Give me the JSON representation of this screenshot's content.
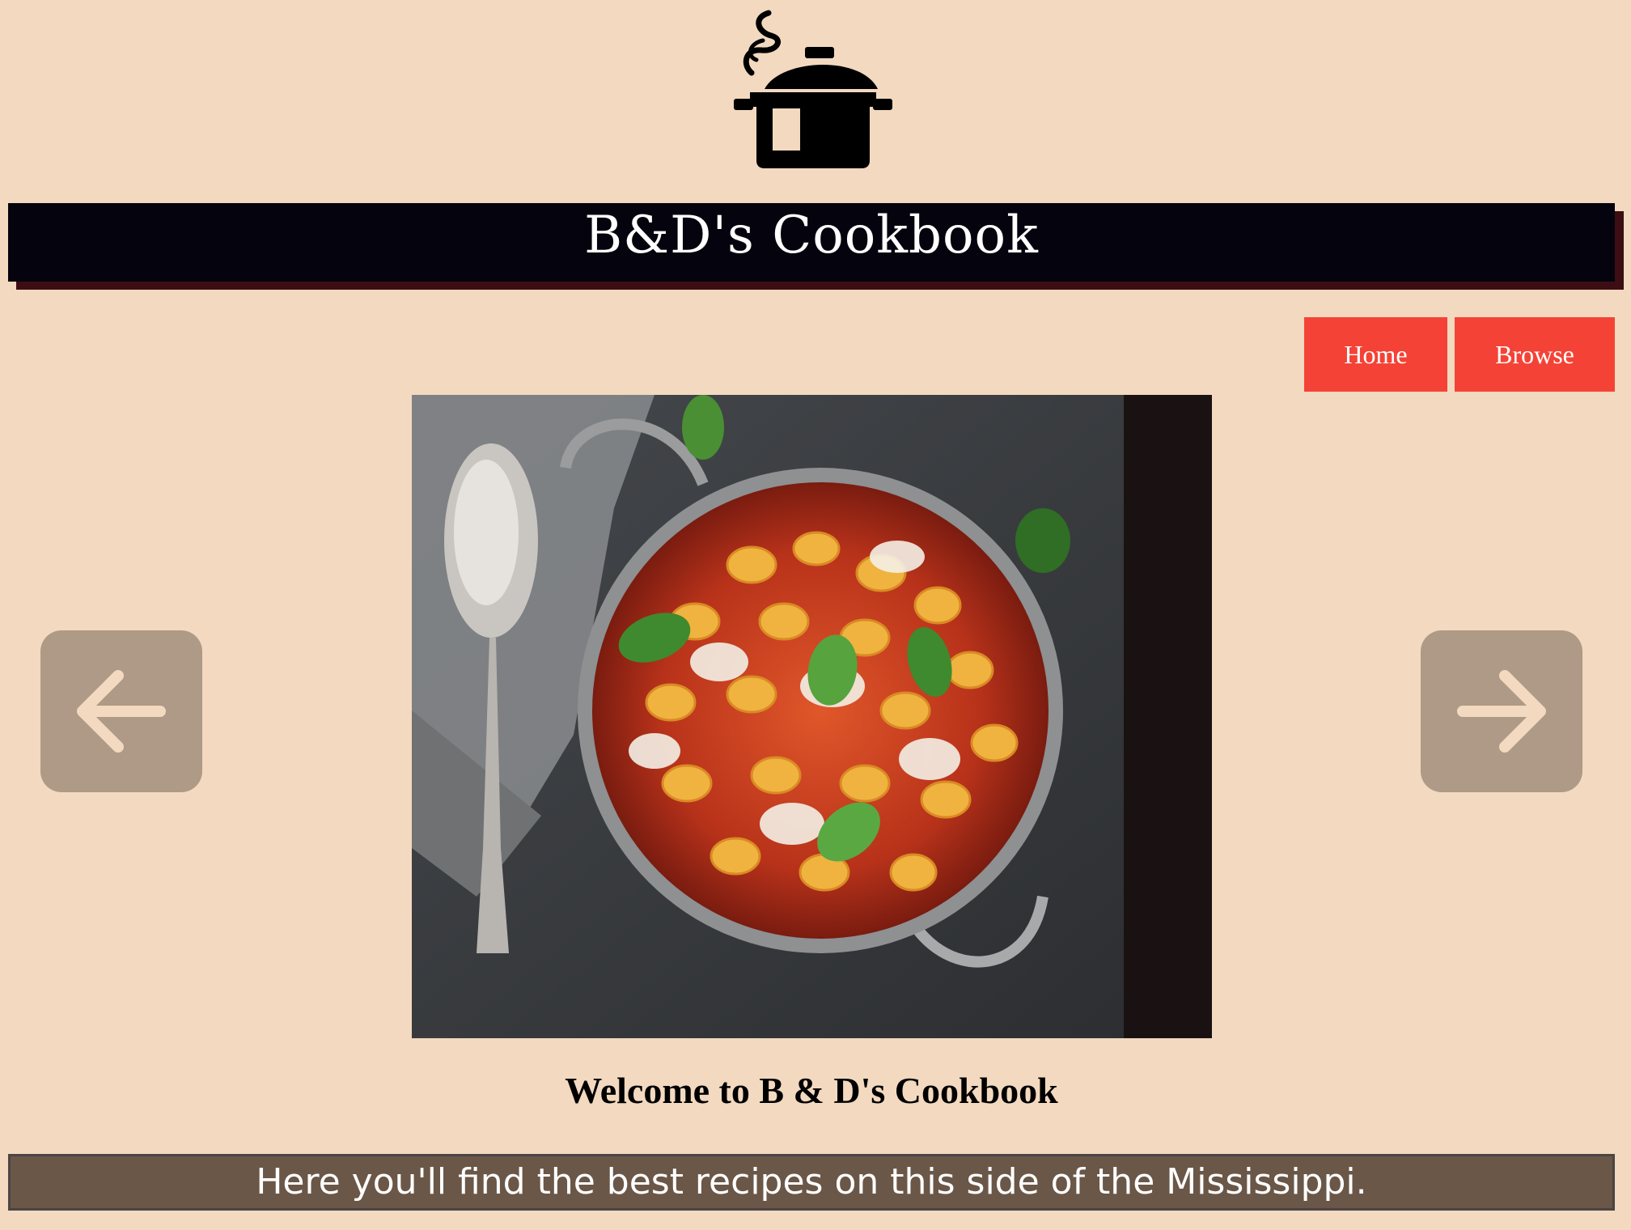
{
  "header": {
    "logo_icon": "cooking-pot-icon",
    "title": "B&D's Cookbook"
  },
  "nav": {
    "home_label": "Home",
    "browse_label": "Browse"
  },
  "carousel": {
    "prev_icon": "arrow-left-icon",
    "next_icon": "arrow-right-icon",
    "image_subject": "gnocchi with tomato sauce, mozzarella and basil in a pan with a spoon"
  },
  "main": {
    "welcome_heading": "Welcome to B & D's Cookbook",
    "tagline": "Here you'll find the best recipes on this side of the Mississippi."
  },
  "colors": {
    "page_background": "#f2d9bf",
    "title_bar": "#05040e",
    "title_bar_shadow": "#3d0d14",
    "nav_button": "#f44336",
    "carousel_button": "#ae9a86",
    "tagline_bar": "#6a5748"
  }
}
